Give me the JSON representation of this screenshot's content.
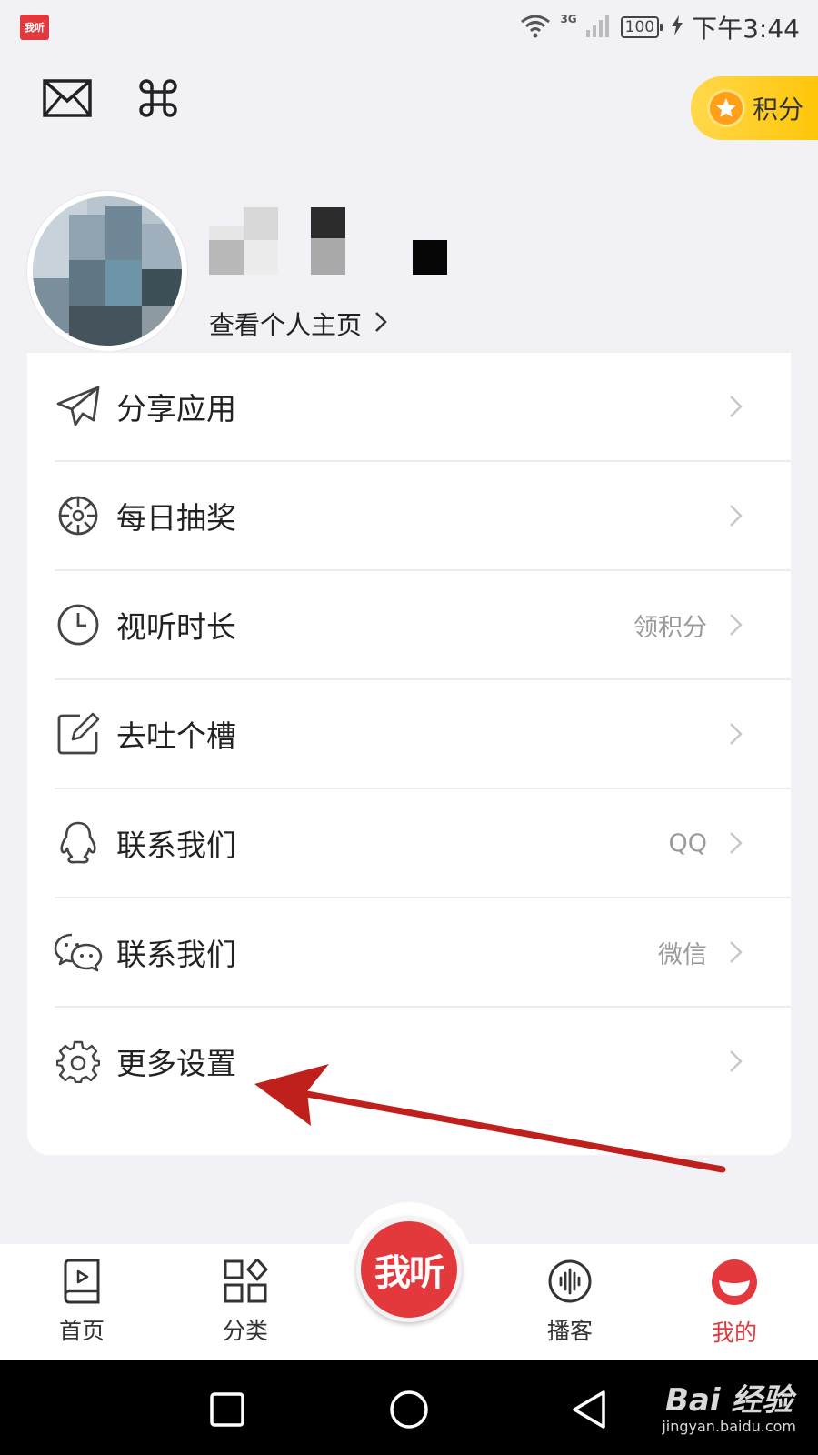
{
  "status_bar": {
    "app_badge": "我听",
    "network": "3G",
    "battery": "100",
    "time": "下午3:44"
  },
  "header": {
    "mail_icon": "envelope-icon",
    "scan_icon": "command-icon",
    "points_label": "积分"
  },
  "profile": {
    "view_profile_label": "查看个人主页"
  },
  "menu": [
    {
      "icon": "paper-plane-icon",
      "label": "分享应用",
      "hint": ""
    },
    {
      "icon": "lottery-wheel-icon",
      "label": "每日抽奖",
      "hint": ""
    },
    {
      "icon": "clock-icon",
      "label": "视听时长",
      "hint": "领积分"
    },
    {
      "icon": "edit-icon",
      "label": "去吐个槽",
      "hint": ""
    },
    {
      "icon": "qq-icon",
      "label": "联系我们",
      "hint": "QQ"
    },
    {
      "icon": "wechat-icon",
      "label": "联系我们",
      "hint": "微信"
    },
    {
      "icon": "gear-icon",
      "label": "更多设置",
      "hint": ""
    }
  ],
  "tabs": {
    "home": "首页",
    "category": "分类",
    "center": "我听",
    "podcast": "播客",
    "mine": "我的"
  },
  "watermark": {
    "main": "Bai 经验",
    "sub": "jingyan.baidu.com"
  },
  "colors": {
    "accent": "#e4393c",
    "points": "#ffc400",
    "background": "#f2f2f6",
    "annotation": "#c0201c"
  }
}
